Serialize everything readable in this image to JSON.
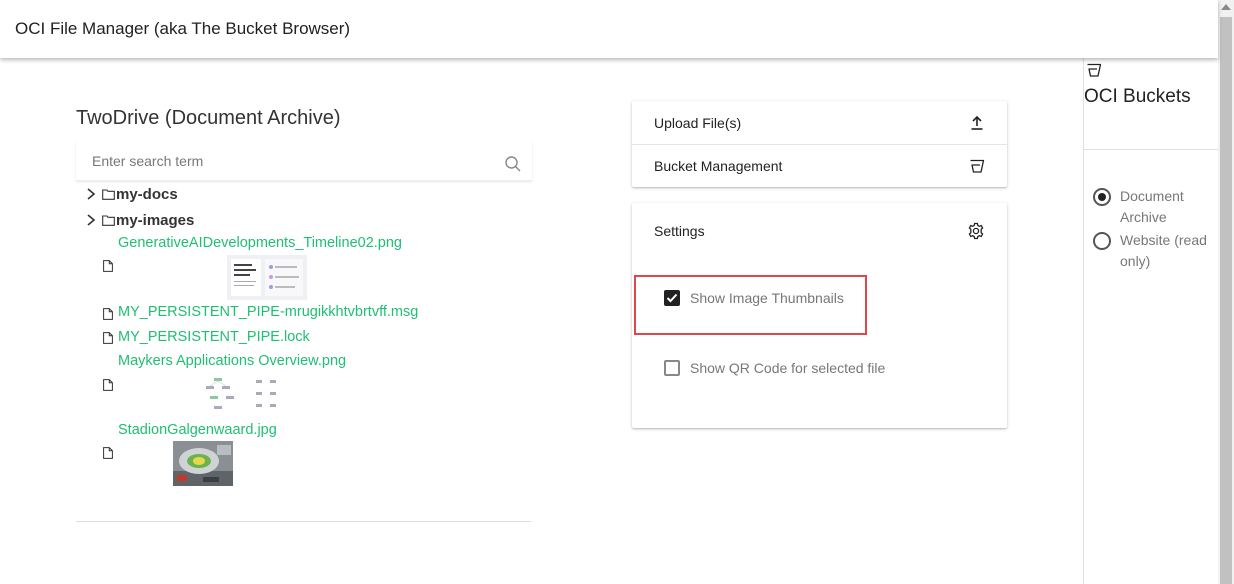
{
  "app": {
    "title": "OCI File Manager (aka The Bucket Browser)"
  },
  "archive": {
    "title": "TwoDrive (Document Archive)",
    "search": {
      "placeholder": "Enter search term",
      "value": ""
    },
    "folders": [
      {
        "name": "my-docs"
      },
      {
        "name": "my-images"
      }
    ],
    "files": [
      {
        "name": "GenerativeAIDevelopments_Timeline02.png",
        "has_thumbnail": true
      },
      {
        "name": "MY_PERSISTENT_PIPE-mrugikkhtvbrtvff.msg",
        "has_thumbnail": false
      },
      {
        "name": "MY_PERSISTENT_PIPE.lock",
        "has_thumbnail": false
      },
      {
        "name": "Maykers Applications Overview.png",
        "has_thumbnail": true
      },
      {
        "name": "StadionGalgenwaard.jpg",
        "has_thumbnail": true
      }
    ]
  },
  "actions": {
    "upload_label": "Upload File(s)",
    "bucket_management_label": "Bucket Management"
  },
  "settings": {
    "title": "Settings",
    "show_thumbnails": {
      "label": "Show Image Thumbnails",
      "checked": true
    },
    "show_qr": {
      "label": "Show QR Code for selected file",
      "checked": false
    }
  },
  "buckets": {
    "title": "OCI Buckets",
    "options": [
      {
        "label": "Document Archive",
        "selected": true
      },
      {
        "label": "Website (read only)",
        "selected": false
      }
    ]
  },
  "colors": {
    "link": "#1fbf74",
    "highlight": "#e0474c"
  }
}
